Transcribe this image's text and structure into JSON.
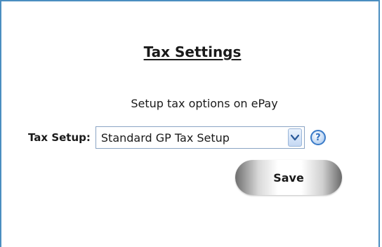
{
  "page": {
    "title": "Tax Settings",
    "subtitle": "Setup tax options on ePay"
  },
  "tax_setup": {
    "label": "Tax Setup:",
    "selected_value": "Standard GP Tax Setup",
    "help_icon": "question-mark-icon",
    "dropdown_icon": "chevron-down-icon"
  },
  "actions": {
    "save_label": "Save"
  },
  "colors": {
    "frame_border": "#4a8ec0",
    "help_icon": "#3a7bc8",
    "dropdown_border": "#8aa4c4"
  }
}
